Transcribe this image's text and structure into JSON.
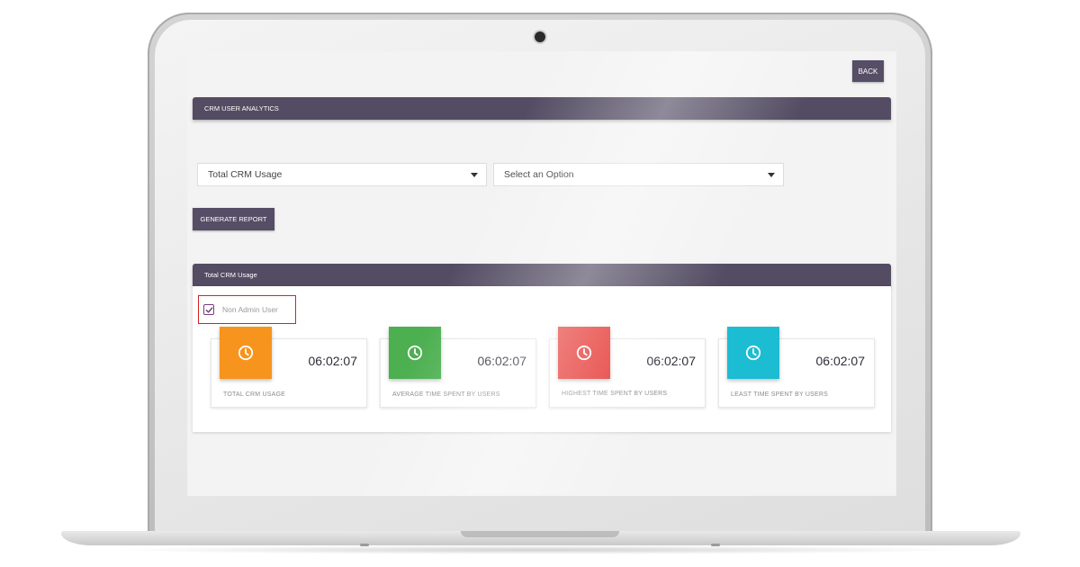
{
  "header": {
    "back_label": "BACK"
  },
  "analytics_bar": {
    "title": "CRM USER ANALYTICS"
  },
  "filters": {
    "report_type": {
      "selected": "Total CRM Usage"
    },
    "option": {
      "selected": "Select an Option"
    }
  },
  "actions": {
    "generate_label": "GENERATE REPORT"
  },
  "results_bar": {
    "title": "Total CRM Usage"
  },
  "filter_checkbox": {
    "label": "Non Admin User",
    "checked": true
  },
  "stats": [
    {
      "label": "TOTAL CRM USAGE",
      "value": "06:02:07",
      "color": "#f7941d",
      "icon": "clock-icon"
    },
    {
      "label": "AVERAGE TIME SPENT BY USERS",
      "value": "06:02:07",
      "color": "#4caf50",
      "icon": "clock-icon"
    },
    {
      "label": "HIGHEST TIME SPENT BY USERS",
      "value": "06:02:07",
      "color": "#e53935",
      "icon": "clock-icon"
    },
    {
      "label": "LEAST TIME SPENT BY USERS",
      "value": "06:02:07",
      "color": "#1cbcd2",
      "icon": "clock-icon"
    }
  ],
  "colors": {
    "header_bar": "#534c63",
    "highlight_border": "#d62222"
  }
}
